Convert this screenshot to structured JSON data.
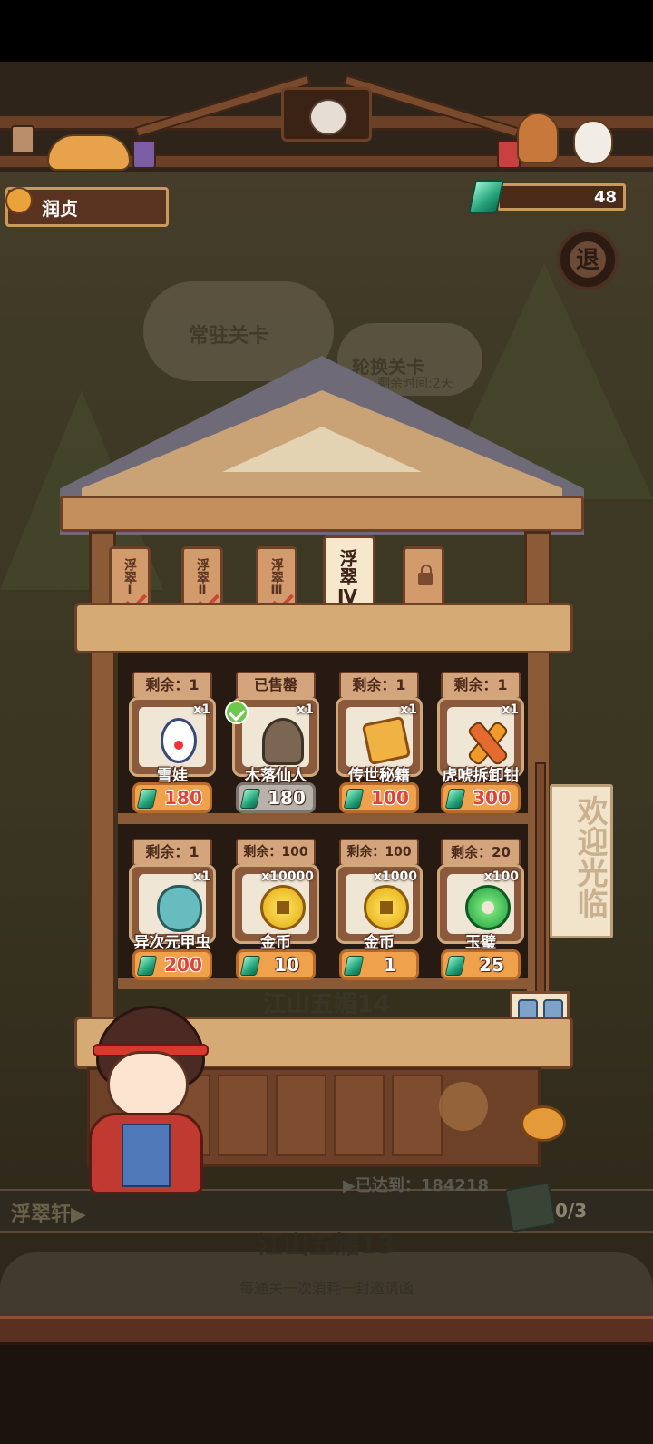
{
  "player": {
    "name": "润贞"
  },
  "currency": {
    "gems": "48",
    "gem_icon": "gem-icon"
  },
  "exit_label": "退",
  "background": {
    "regular_levels": "常驻关卡",
    "rotating_levels": "轮换关卡",
    "rotating_note": "剩余时间:2天",
    "level_behind": "江山五媚14"
  },
  "tabs": [
    {
      "label": "浮翠Ⅰ",
      "state": "done"
    },
    {
      "label": "浮翠Ⅱ",
      "state": "done"
    },
    {
      "label": "浮翠Ⅲ",
      "state": "done"
    },
    {
      "label": "浮翠Ⅳ",
      "state": "active"
    },
    {
      "label": "",
      "state": "locked"
    }
  ],
  "items": [
    {
      "stock": "剩余：1",
      "qty": "x1",
      "name": "雪娃",
      "price": "180",
      "sold": false,
      "icon": "snowman-icon"
    },
    {
      "stock": "已售罄",
      "qty": "x1",
      "name": "木落仙人",
      "price": "180",
      "sold": true,
      "icon": "ghost-icon"
    },
    {
      "stock": "剩余：1",
      "qty": "x1",
      "name": "传世秘籍",
      "price": "100",
      "sold": false,
      "icon": "book-icon"
    },
    {
      "stock": "剩余：1",
      "qty": "x1",
      "name": "虎唬拆卸钳",
      "price": "300",
      "sold": false,
      "icon": "pliers-icon"
    },
    {
      "stock": "剩余：1",
      "qty": "x1",
      "name": "异次元甲虫",
      "price": "200",
      "sold": false,
      "icon": "beetle-icon"
    },
    {
      "stock": "剩余：100",
      "qty": "x10000",
      "name": "金币",
      "price": "10",
      "sold": false,
      "icon": "coin-icon"
    },
    {
      "stock": "剩余：100",
      "qty": "x1000",
      "name": "金币",
      "price": "1",
      "sold": false,
      "icon": "coin-icon"
    },
    {
      "stock": "剩余：20",
      "qty": "x100",
      "name": "玉璧",
      "price": "25",
      "sold": false,
      "icon": "jade-icon"
    }
  ],
  "sign": {
    "text": "欢迎光临"
  },
  "footer": {
    "area_name": "浮翠轩▶",
    "reached": "▶已达到：184218",
    "invites": "0/3",
    "level_name": "江山五媚13",
    "note": "每通关一次消耗一封邀请函"
  }
}
